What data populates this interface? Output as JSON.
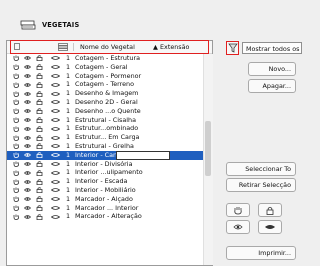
{
  "dialog": {
    "title": "VEGETAIS"
  },
  "header": {
    "name_col": "Nome do Vegetal",
    "ext_col": "Extensão"
  },
  "rows": [
    {
      "num": "1",
      "name": "Cotagem - Estrutura"
    },
    {
      "num": "1",
      "name": "Cotagem - Geral"
    },
    {
      "num": "1",
      "name": "Cotagem - Pormenor"
    },
    {
      "num": "1",
      "name": "Cotagem - Terreno"
    },
    {
      "num": "1",
      "name": "Desenho & Imagem"
    },
    {
      "num": "1",
      "name": "Desenho 2D - Geral"
    },
    {
      "num": "1",
      "name": "Desenho ...o Quente"
    },
    {
      "num": "1",
      "name": "Estrutural - Cisalha"
    },
    {
      "num": "1",
      "name": "Estrutur...ombinado"
    },
    {
      "num": "1",
      "name": "Estrutur... Em Carga"
    },
    {
      "num": "1",
      "name": "Estrutural - Grelha"
    },
    {
      "num": "1",
      "name": "Interior - Candeeiro",
      "selected": true
    },
    {
      "num": "1",
      "name": "Interior - Divisória"
    },
    {
      "num": "1",
      "name": "Interior ...ulipamento"
    },
    {
      "num": "1",
      "name": "Interior - Escada"
    },
    {
      "num": "1",
      "name": "Interior - Mobiliário"
    },
    {
      "num": "1",
      "name": "Marcador - Alçado"
    },
    {
      "num": "1",
      "name": "Marcador ... Interior"
    },
    {
      "num": "1",
      "name": "Marcador - Alteração"
    }
  ],
  "filter": {
    "value": "Mostrar todos os"
  },
  "buttons": {
    "new": "Novo...",
    "delete": "Apagar...",
    "select_all": "Seleccionar To",
    "deselect_all": "Retirar Selecção",
    "print": "Imprimir..."
  },
  "colors": {
    "selection": "#1f5fbf",
    "highlight": "#e02020"
  }
}
